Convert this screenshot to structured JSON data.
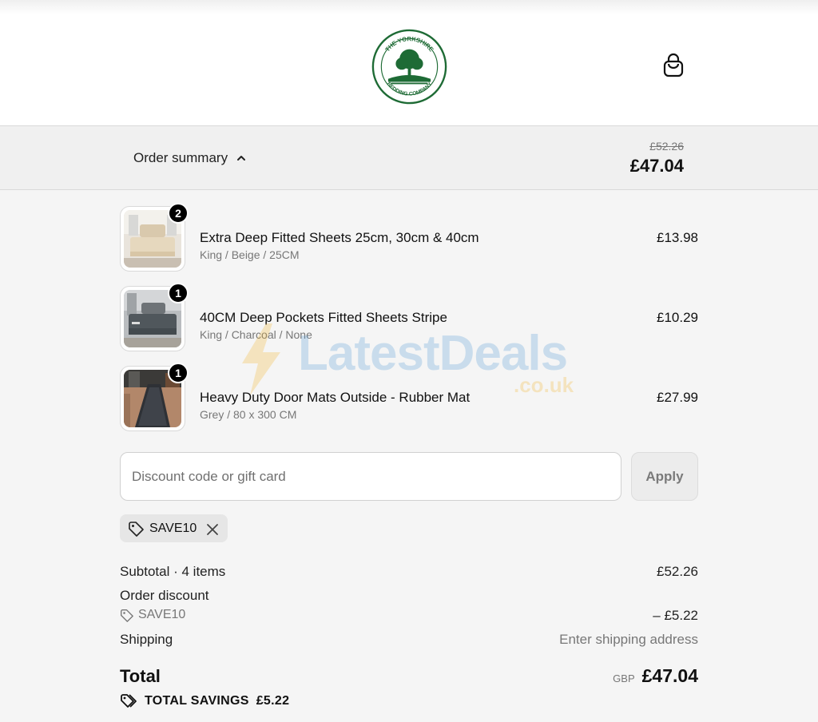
{
  "brand": {
    "logo_top_text": "THE YORKSHIRE",
    "logo_bottom_text": "BEDDING COMPANY",
    "color": "#1e6b35"
  },
  "summary": {
    "toggle_label": "Order summary",
    "original_price": "£52.26",
    "total": "£47.04"
  },
  "items": [
    {
      "quantity": "2",
      "name": "Extra Deep Fitted Sheets 25cm, 30cm & 40cm",
      "variant": "King / Beige / 25CM",
      "price": "£13.98"
    },
    {
      "quantity": "1",
      "name": "40CM Deep Pockets Fitted Sheets Stripe",
      "variant": "King / Charcoal / None",
      "price": "£10.29"
    },
    {
      "quantity": "1",
      "name": "Heavy Duty Door Mats Outside - Rubber Mat",
      "variant": "Grey / 80 x 300 CM",
      "price": "£27.99"
    }
  ],
  "watermark": {
    "text": "LatestDeals",
    "suffix": ".co.uk"
  },
  "discount": {
    "placeholder": "Discount code or gift card",
    "apply_label": "Apply",
    "applied_code": "SAVE10"
  },
  "totals": {
    "subtotal_label": "Subtotal · 4 items",
    "subtotal_value": "£52.26",
    "order_discount_label": "Order discount",
    "discount_code": "SAVE10",
    "discount_value": "– £5.22",
    "shipping_label": "Shipping",
    "shipping_value": "Enter shipping address",
    "total_label": "Total",
    "currency": "GBP",
    "total_value": "£47.04",
    "savings_label": "TOTAL SAVINGS",
    "savings_value": "£5.22"
  }
}
